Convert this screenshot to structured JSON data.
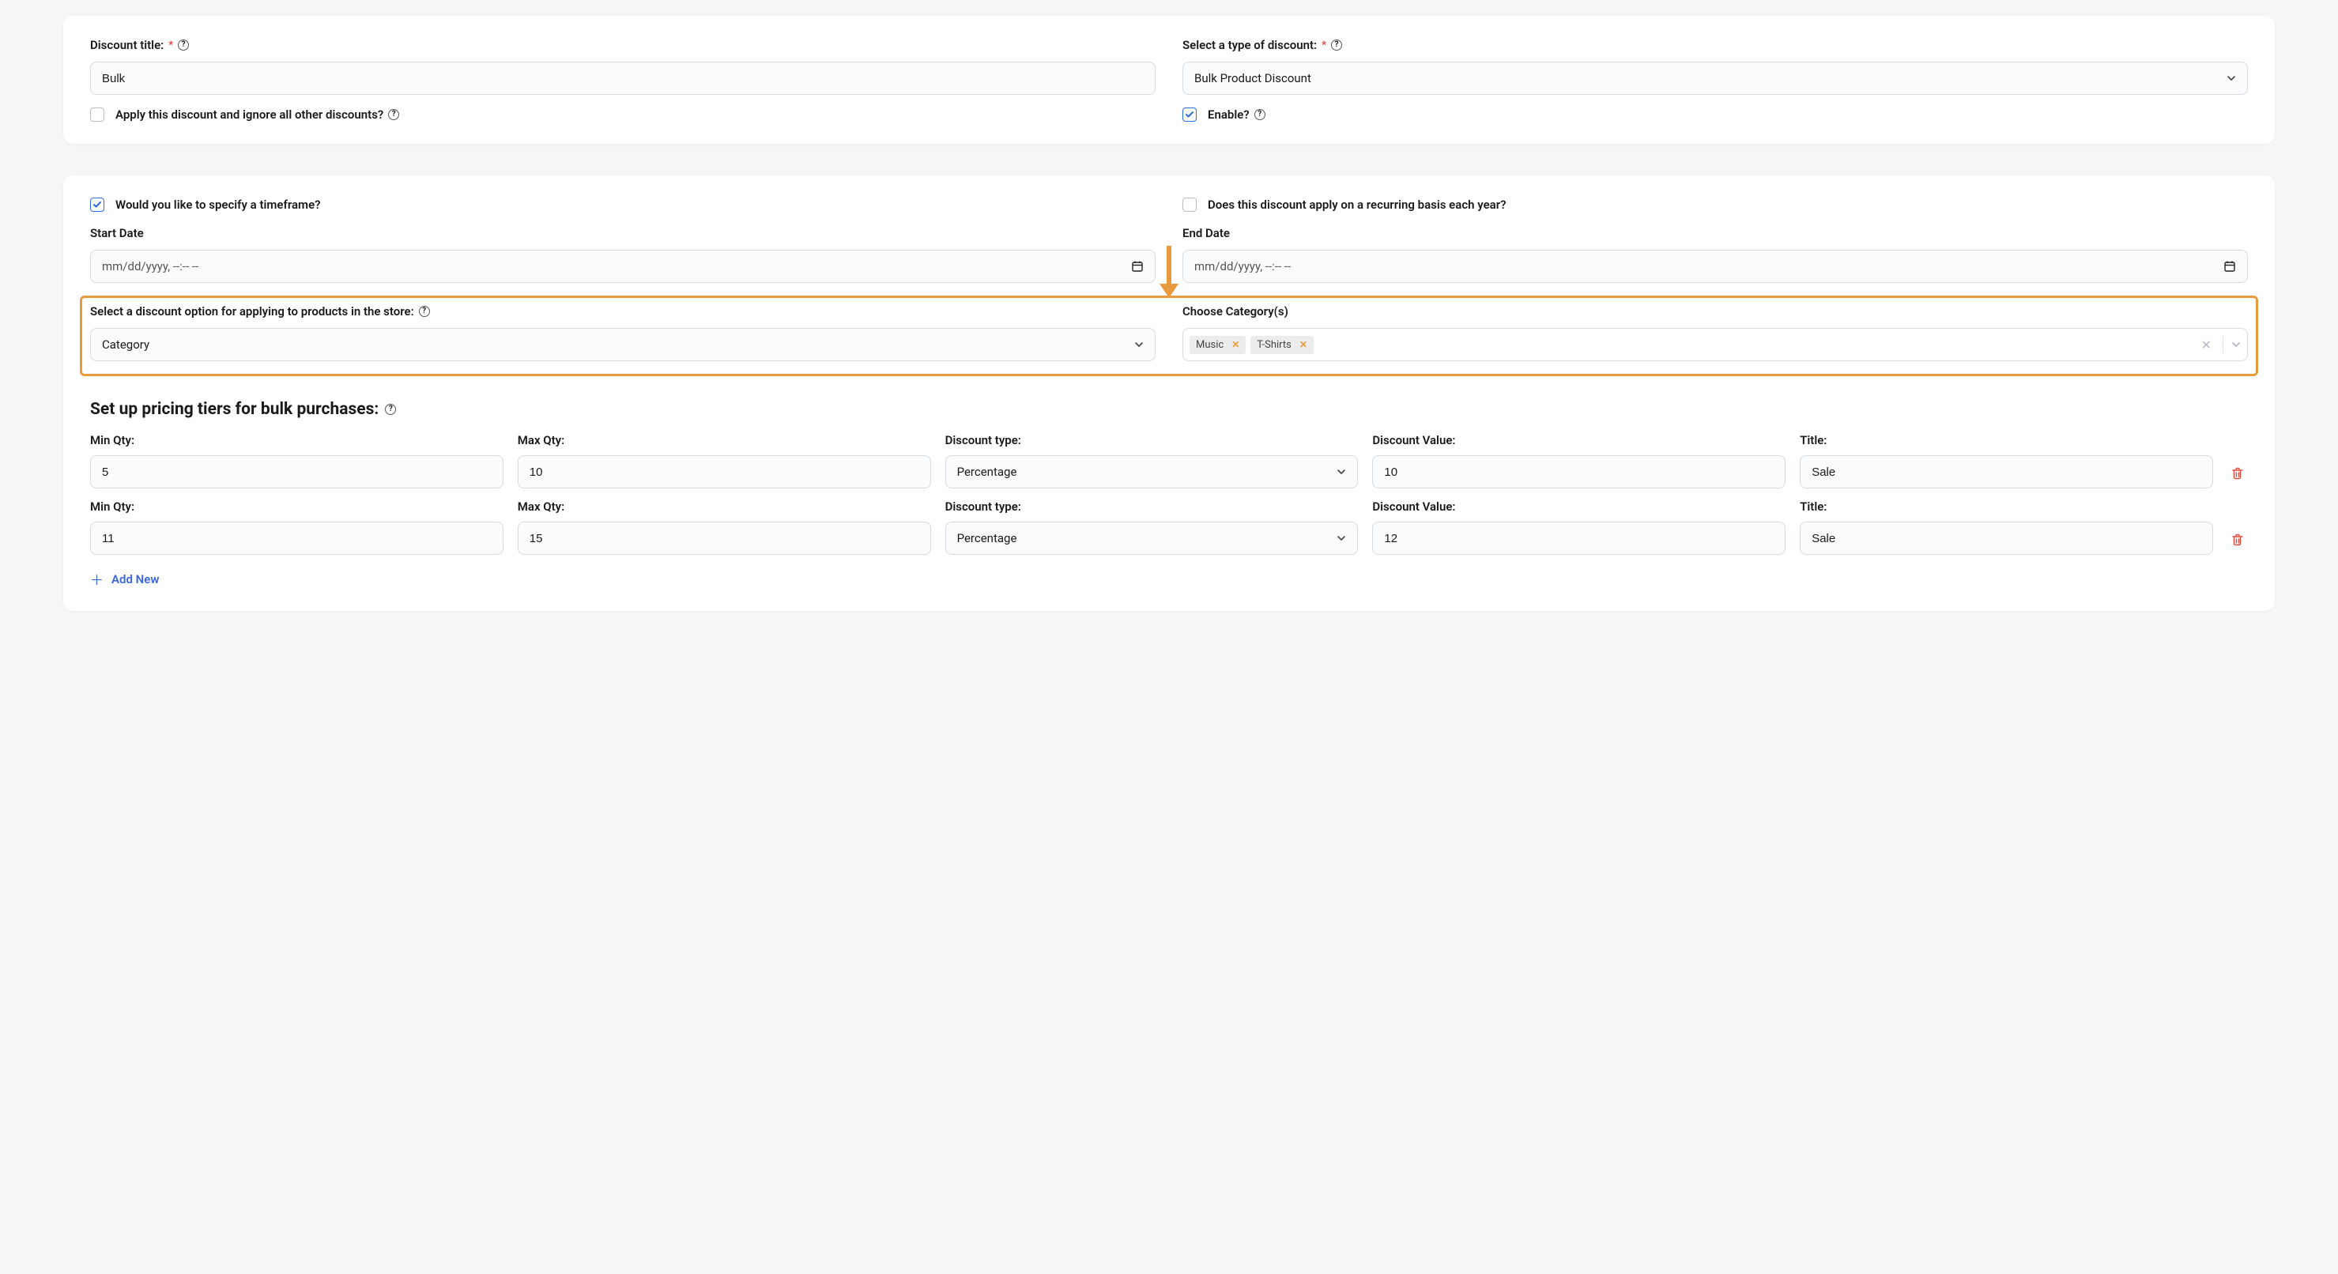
{
  "card1": {
    "title_label": "Discount title:",
    "title_value": "Bulk",
    "type_label": "Select a type of discount:",
    "type_value": "Bulk Product Discount",
    "ignore_label": "Apply this discount and ignore all other discounts?",
    "ignore_checked": false,
    "enable_label": "Enable?",
    "enable_checked": true
  },
  "card2": {
    "timeframe_label": "Would you like to specify a timeframe?",
    "timeframe_checked": true,
    "recurring_label": "Does this discount apply on a recurring basis each year?",
    "recurring_checked": false,
    "start_label": "Start Date",
    "start_placeholder": "mm/dd/yyyy, --:-- --",
    "end_label": "End Date",
    "end_placeholder": "mm/dd/yyyy, --:-- --",
    "option_label": "Select a discount option for applying to products in the store:",
    "option_value": "Category",
    "category_label": "Choose Category(s)",
    "tags": [
      "Music",
      "T-Shirts"
    ],
    "tiers_heading": "Set up pricing tiers for bulk purchases:",
    "th": {
      "min": "Min Qty:",
      "max": "Max Qty:",
      "dtype": "Discount type:",
      "dval": "Discount Value:",
      "title": "Title:"
    },
    "tiers": [
      {
        "min": "5",
        "max": "10",
        "dtype": "Percentage",
        "dval": "10",
        "title": "Sale"
      },
      {
        "min": "11",
        "max": "15",
        "dtype": "Percentage",
        "dval": "12",
        "title": "Sale"
      }
    ],
    "add_new": "Add New"
  }
}
